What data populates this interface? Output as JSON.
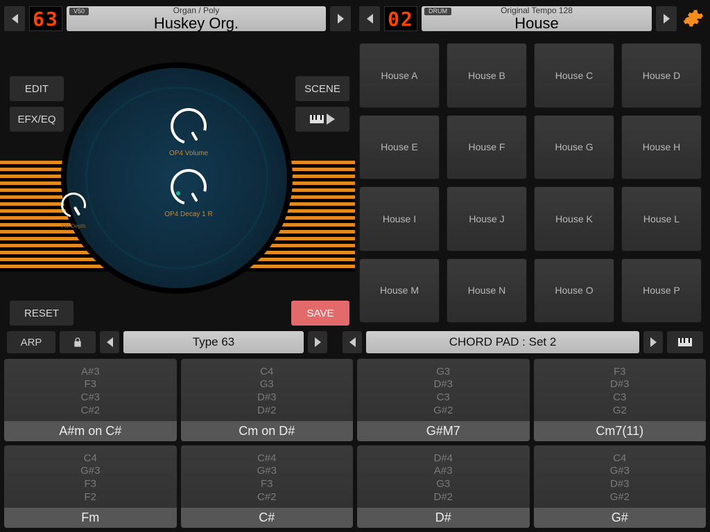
{
  "synth": {
    "prev_arrow": "◀",
    "next_arrow": "▶",
    "number": "63",
    "tag": "V50",
    "sub": "Organ / Poly",
    "name": "Huskey Org.",
    "knob1": "OP4 Volume",
    "knob2": "OP4 Decay 1 R",
    "knob3": "FM Depth",
    "btn_edit": "EDIT",
    "btn_efx": "EFX/EQ",
    "btn_scene": "SCENE",
    "btn_reset": "RESET",
    "btn_save": "SAVE"
  },
  "drum": {
    "number": "02",
    "tag": "DRUM",
    "sub": "Original Tempo 128",
    "name": "House",
    "pads": [
      "House A",
      "House B",
      "House C",
      "House D",
      "House E",
      "House F",
      "House G",
      "House H",
      "House I",
      "House J",
      "House K",
      "House L",
      "House M",
      "House N",
      "House O",
      "House P"
    ]
  },
  "arp": {
    "label": "ARP",
    "type": "Type 63"
  },
  "chordbar": {
    "label": "CHORD PAD : Set 2"
  },
  "chords": [
    {
      "notes": [
        "A#3",
        "F3",
        "C#3",
        "C#2"
      ],
      "label": "A#m on C#"
    },
    {
      "notes": [
        "C4",
        "G3",
        "D#3",
        "D#2"
      ],
      "label": "Cm on D#"
    },
    {
      "notes": [
        "G3",
        "D#3",
        "C3",
        "G#2"
      ],
      "label": "G#M7"
    },
    {
      "notes": [
        "F3",
        "D#3",
        "C3",
        "G2"
      ],
      "label": "Cm7(11)"
    },
    {
      "notes": [
        "C4",
        "G#3",
        "F3",
        "F2"
      ],
      "label": "Fm"
    },
    {
      "notes": [
        "C#4",
        "G#3",
        "F3",
        "C#2"
      ],
      "label": "C#"
    },
    {
      "notes": [
        "D#4",
        "A#3",
        "G3",
        "D#2"
      ],
      "label": "D#"
    },
    {
      "notes": [
        "C4",
        "G#3",
        "D#3",
        "G#2"
      ],
      "label": "G#"
    }
  ]
}
